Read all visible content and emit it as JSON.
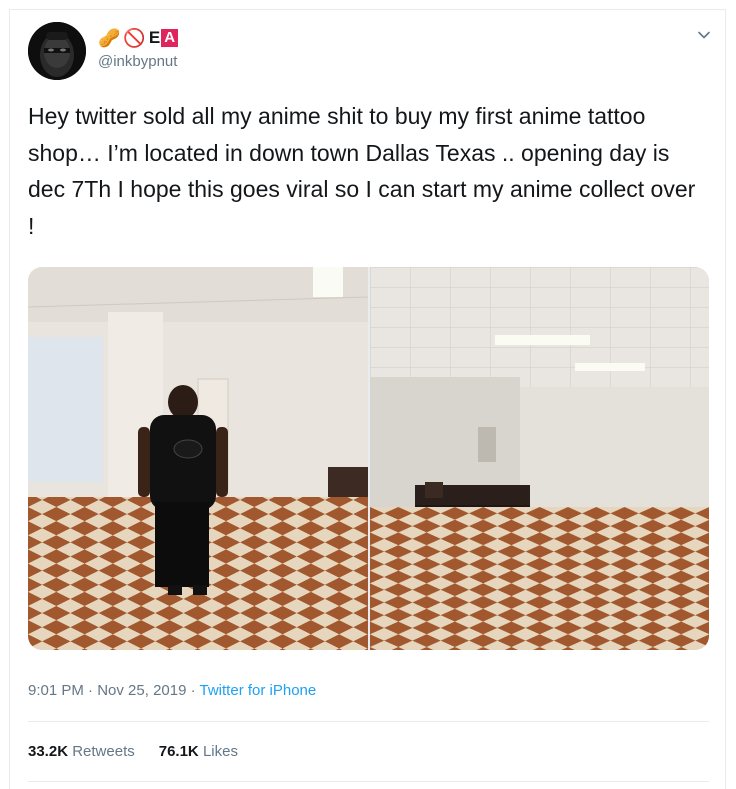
{
  "author": {
    "name_emoji_1": "🥜",
    "name_emoji_2": "🚫",
    "name_letter_e": "E",
    "name_letter_a": "A",
    "handle": "@inkbypnut",
    "avatar_icon": "user-avatar-photo"
  },
  "tweet": {
    "text": "Hey twitter sold all my anime shit to buy my first anime tattoo shop… I’m located in down town Dallas Texas .. opening day is dec 7Th I hope this goes viral so I can start my anime collect over !"
  },
  "meta": {
    "time": "9:01 PM",
    "sep1": " · ",
    "date": "Nov 25, 2019",
    "sep2": " · ",
    "source": "Twitter for iPhone"
  },
  "stats": {
    "retweets_count": "33.2K",
    "retweets_label": "Retweets",
    "likes_count": "76.1K",
    "likes_label": "Likes"
  },
  "colors": {
    "accent": "#1da1f2",
    "muted": "#657786",
    "text": "#14171a",
    "border": "#e6ecf0"
  },
  "icons": {
    "menu": "chevron-down-icon"
  }
}
